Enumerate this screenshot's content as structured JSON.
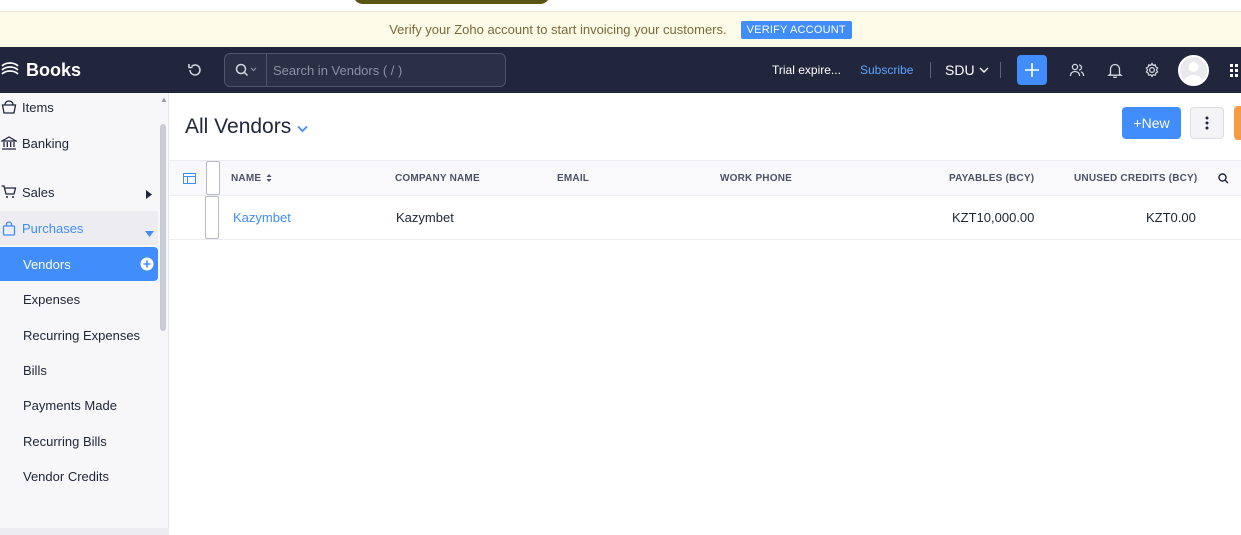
{
  "banner": {
    "message": "Verify your Zoho account to start invoicing your customers.",
    "verify_label": "VERIFY ACCOUNT"
  },
  "header": {
    "app_name": "Books",
    "search_placeholder": "Search in Vendors ( / )",
    "trial_text": "Trial expire...",
    "subscribe_label": "Subscribe",
    "org_name": "SDU"
  },
  "sidebar": {
    "items": [
      {
        "label": "Items",
        "icon": "basket-icon"
      },
      {
        "label": "Banking",
        "icon": "bank-icon"
      },
      {
        "label": "Sales",
        "icon": "cart-icon"
      },
      {
        "label": "Purchases",
        "icon": "bag-icon"
      }
    ],
    "purchases_sub": [
      {
        "label": "Vendors"
      },
      {
        "label": "Expenses"
      },
      {
        "label": "Recurring Expenses"
      },
      {
        "label": "Bills"
      },
      {
        "label": "Payments Made"
      },
      {
        "label": "Recurring Bills"
      },
      {
        "label": "Vendor Credits"
      }
    ]
  },
  "main": {
    "title": "All Vendors",
    "new_label": "+New",
    "columns": {
      "name": "NAME",
      "company": "COMPANY NAME",
      "email": "EMAIL",
      "phone": "WORK PHONE",
      "payables": "PAYABLES (BCY)",
      "credits": "UNUSED CREDITS (BCY)"
    },
    "rows": [
      {
        "name": "Kazymbet",
        "company": "Kazymbet",
        "email": "",
        "phone": "",
        "payables": "KZT10,000.00",
        "credits": "KZT0.00"
      }
    ]
  },
  "colors": {
    "accent": "#408dfb",
    "header_bg": "#21263c",
    "banner_bg": "#fcfbe8"
  }
}
